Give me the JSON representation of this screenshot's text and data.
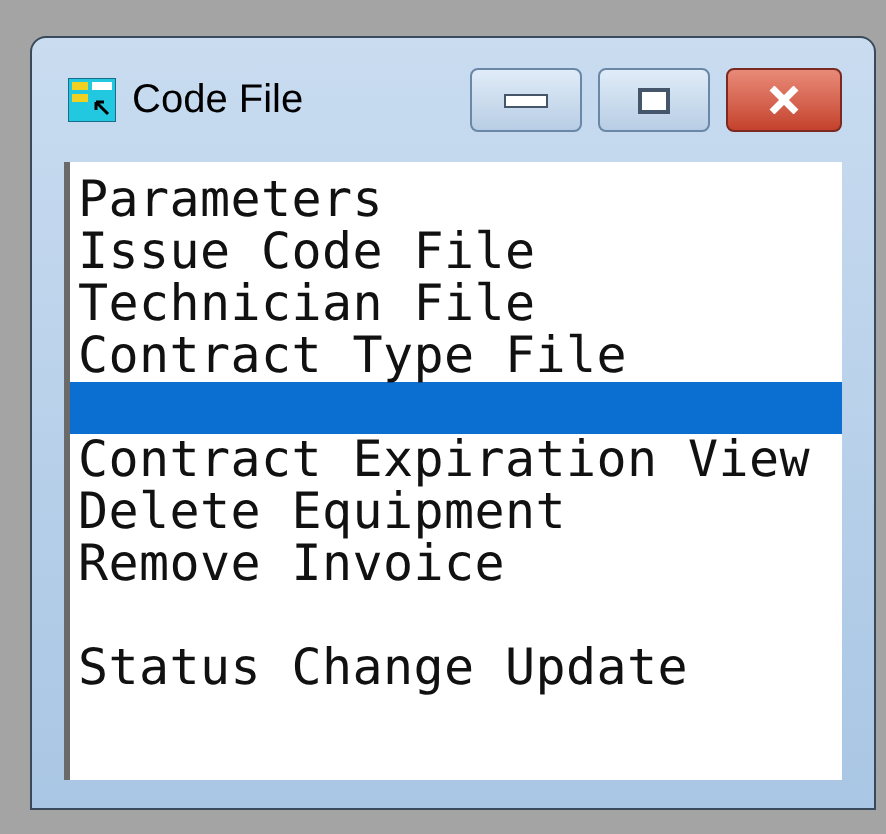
{
  "window": {
    "title": "Code File"
  },
  "list": [
    {
      "kind": "entry",
      "label": "Parameters",
      "selected": false
    },
    {
      "kind": "entry",
      "label": "Issue Code File",
      "selected": false
    },
    {
      "kind": "entry",
      "label": "Technician File",
      "selected": false
    },
    {
      "kind": "entry",
      "label": "Contract Type File",
      "selected": false
    },
    {
      "kind": "blank",
      "selected": true
    },
    {
      "kind": "entry",
      "label": "Contract Expiration View",
      "selected": false
    },
    {
      "kind": "entry",
      "label": "Delete Equipment",
      "selected": false
    },
    {
      "kind": "entry",
      "label": "Remove Invoice",
      "selected": false
    },
    {
      "kind": "blank",
      "selected": false
    },
    {
      "kind": "entry",
      "label": "Status Change Update",
      "selected": false
    }
  ]
}
